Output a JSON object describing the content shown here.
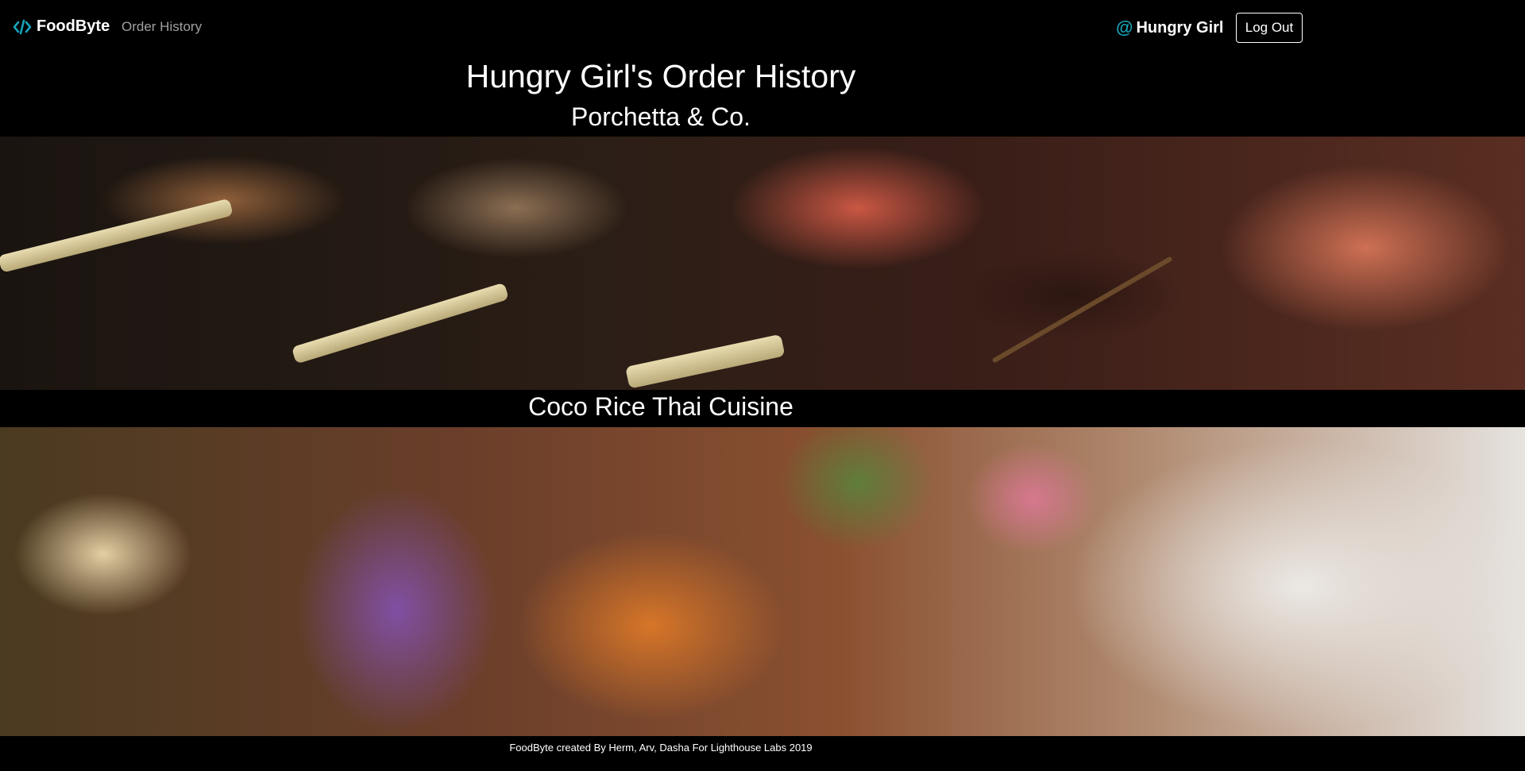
{
  "navbar": {
    "brand": "FoodByte",
    "brand_icon": "code-icon",
    "links": [
      {
        "label": "Order History"
      }
    ],
    "user": {
      "name": "Hungry Girl",
      "icon": "at-icon",
      "icon_glyph": "@"
    },
    "logout_label": "Log Out"
  },
  "main": {
    "title": "Hungry Girl's Order History",
    "orders": [
      {
        "restaurant": "Porchetta & Co.",
        "image": "grilled skewers"
      },
      {
        "restaurant": "Coco Rice Thai Cuisine",
        "image": "shrimp and eggplant stir-fry"
      }
    ]
  },
  "footer": {
    "text": "FoodByte created By Herm, Arv, Dasha For Lighthouse Labs 2019"
  },
  "colors": {
    "background": "#000000",
    "accent": "#17a2b8",
    "nav_link": "#a0a0a0"
  }
}
